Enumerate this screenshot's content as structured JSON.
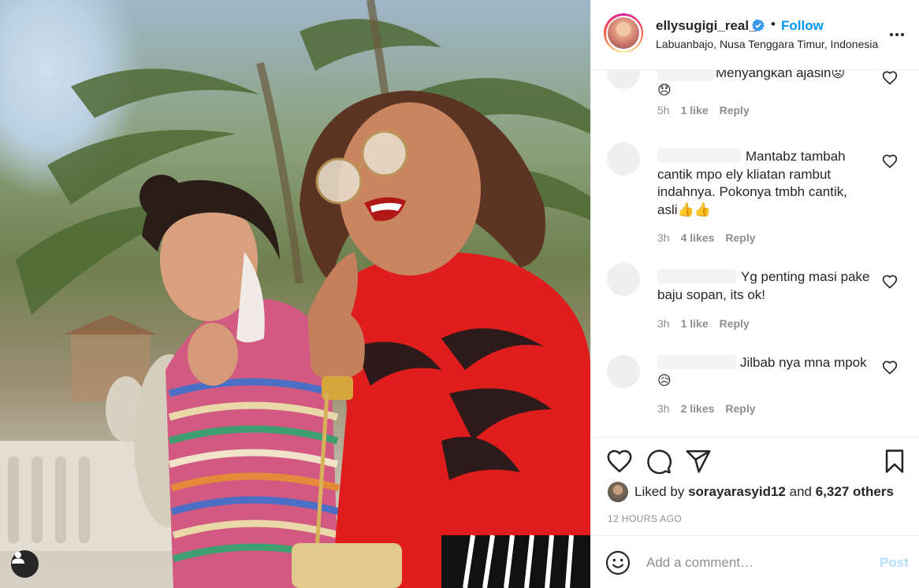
{
  "header": {
    "username": "ellysugigi_real_",
    "separator": "•",
    "follow_label": "Follow",
    "location": "Labuanbajo, Nusa Tenggara Timur, Indonesia",
    "verified_icon": "verified-badge-icon"
  },
  "comments": [
    {
      "text_line1": "Menyangkan ajasih😟",
      "text_line2": "😞",
      "time": "5h",
      "likes": "1 like",
      "reply": "Reply"
    },
    {
      "text": "Mantabz tambah cantik mpo ely kliatan rambut indahnya. Pokonya tmbh cantik, asli👍👍",
      "time": "3h",
      "likes": "4 likes",
      "reply": "Reply"
    },
    {
      "text": "Yg penting masi pake baju sopan, its ok!",
      "time": "3h",
      "likes": "1 like",
      "reply": "Reply"
    },
    {
      "text": "Jilbab nya mna mpok😥",
      "time": "3h",
      "likes": "2 likes",
      "reply": "Reply"
    }
  ],
  "likes": {
    "prefix": "Liked by",
    "user": "sorayarasyid12",
    "middle": "and",
    "others": "6,327 others"
  },
  "timestamp": "12 HOURS AGO",
  "add_comment": {
    "placeholder": "Add a comment…",
    "post_label": "Post"
  },
  "colors": {
    "accent": "#0095f6",
    "post_disabled": "#b2dffc",
    "muted": "#8e8e8e",
    "text": "#262626"
  }
}
